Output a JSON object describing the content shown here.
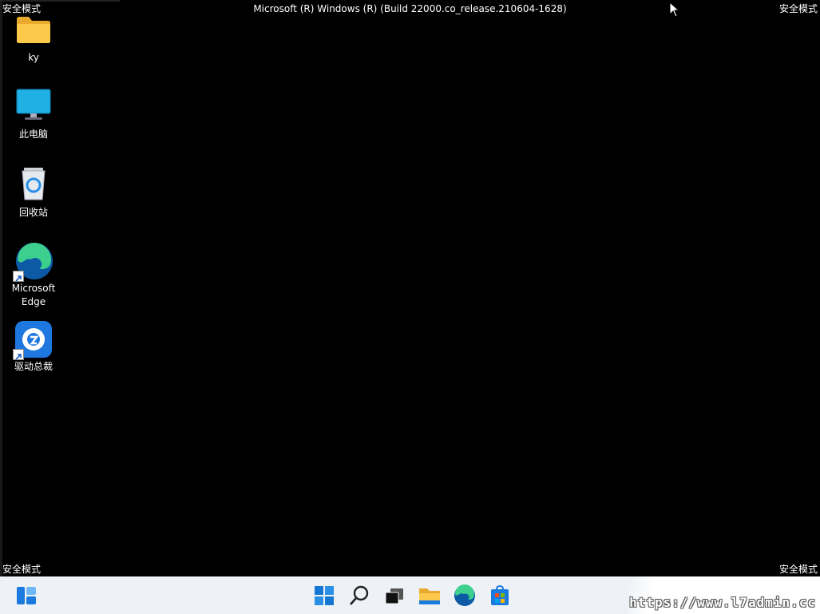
{
  "safe_mode_label": "安全模式",
  "build_string": "Microsoft (R) Windows (R) (Build 22000.co_release.210604-1628)",
  "desktop_icons": [
    {
      "label": "ky",
      "icon": "folder-icon"
    },
    {
      "label": "此电脑",
      "icon": "monitor-icon"
    },
    {
      "label": "回收站",
      "icon": "recycle-bin-icon"
    },
    {
      "label": "Microsoft Edge",
      "icon": "edge-icon"
    },
    {
      "label": "驱动总裁",
      "icon": "driver-tool-icon"
    }
  ],
  "taskbar": {
    "items": [
      "widgets-icon",
      "start-icon",
      "search-icon",
      "task-view-icon",
      "file-explorer-icon",
      "edge-icon",
      "store-icon"
    ]
  },
  "watermark": "https://www.l7admin.cc",
  "colors": {
    "desktop_bg": "#000000",
    "taskbar_bg": "#eef1f6",
    "accent": "#0a6ed1"
  }
}
